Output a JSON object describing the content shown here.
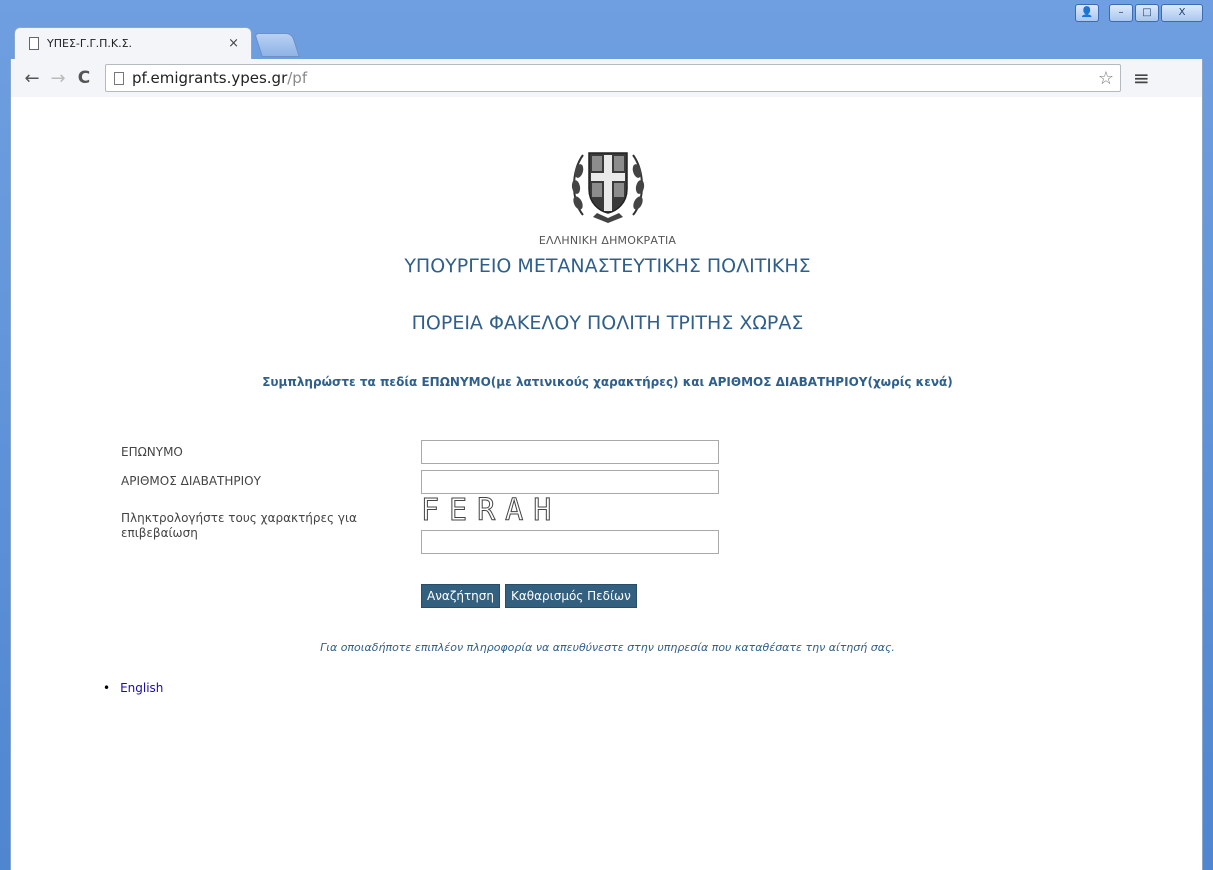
{
  "browser": {
    "tab_title": "ΥΠΕΣ-Γ.Γ.Π.Κ.Σ.",
    "tab_close": "×",
    "url_host": "pf.emigrants.ypes.gr",
    "url_path": "/pf",
    "nav": {
      "back": "←",
      "forward": "→",
      "reload": "C"
    },
    "star": "☆",
    "menu": "≡",
    "window_controls": {
      "user": "👤",
      "minimize": "–",
      "maximize": "□",
      "close": "X"
    }
  },
  "header": {
    "republic": "ΕΛΛΗΝΙΚΗ ΔΗΜΟΚΡΑΤΙΑ",
    "ministry": "ΥΠΟΥΡΓΕΙΟ ΜΕΤΑΝΑΣΤΕΥΤΙΚΗΣ ΠΟΛΙΤΙΚΗΣ",
    "service": "ΠΟΡΕΙΑ ΦΑΚΕΛΟΥ ΠΟΛΙΤΗ ΤΡΙΤΗΣ ΧΩΡΑΣ"
  },
  "form": {
    "instructions": "Συμπληρώστε τα πεδία ΕΠΩΝΥΜΟ(με λατινικούς χαρακτήρες) και ΑΡΙΘΜΟΣ ΔΙΑΒΑΤΗΡΙΟΥ(χωρίς κενά)",
    "surname_label": "ΕΠΩΝΥΜΟ",
    "surname_value": "",
    "passport_label": "ΑΡΙΘΜΟΣ ΔΙΑΒΑΤΗΡΙΟΥ",
    "passport_value": "",
    "captcha_label": "Πληκτρολογήστε τους χαρακτήρες για επιβεβαίωση",
    "captcha_text": "FERAH",
    "captcha_value": "",
    "search_button": "Αναζήτηση",
    "clear_button": "Καθαρισμός Πεδίων"
  },
  "info": "Για οποιαδήποτε επιπλέον πληροφορία να απευθύνεστε στην υπηρεσία που καταθέσατε την αίτησή σας.",
  "languages": [
    {
      "label": "English"
    }
  ],
  "colors": {
    "heading": "#2f5f8a",
    "button": "#33607f",
    "link": "#1a0dab"
  }
}
